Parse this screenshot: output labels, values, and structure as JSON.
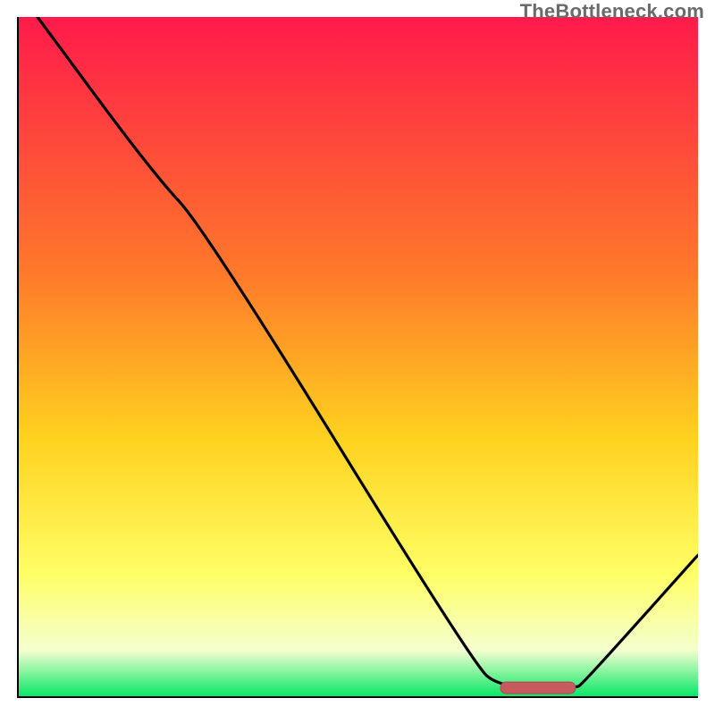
{
  "watermark": "TheBottleneck.com",
  "colors": {
    "gradient_top": "#ff1a4b",
    "gradient_mid1": "#ff7a2a",
    "gradient_mid2": "#ffd21f",
    "gradient_low": "#ffff66",
    "gradient_pale": "#f4ffcf",
    "gradient_green": "#00e663",
    "axis": "#000000",
    "curve": "#000000",
    "marker_fill": "#c65a5f",
    "marker_stroke": "#a84a50"
  },
  "chart_data": {
    "type": "line",
    "title": "",
    "xlabel": "",
    "ylabel": "",
    "xlim": [
      0,
      100
    ],
    "ylim": [
      0,
      100
    ],
    "x": [
      3,
      20,
      27.5,
      67,
      71,
      82,
      83,
      100
    ],
    "y": [
      100,
      77,
      69,
      5,
      1.5,
      1.5,
      2,
      21
    ],
    "optimum_marker": {
      "x_start": 71,
      "x_end": 82,
      "y": 1.5
    }
  }
}
